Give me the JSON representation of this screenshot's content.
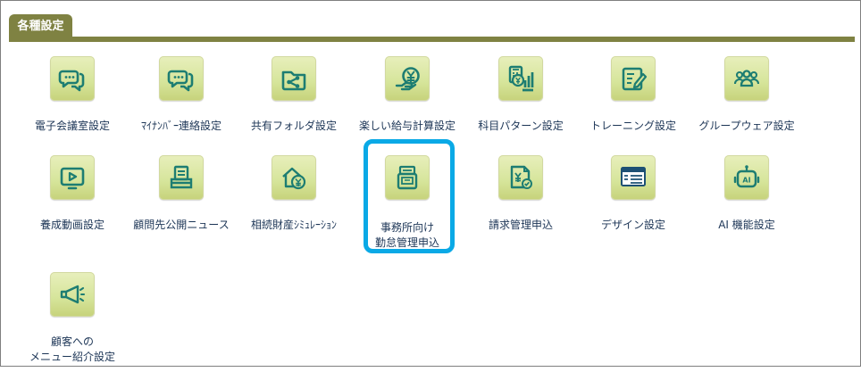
{
  "section": {
    "tab_label": "各種設定"
  },
  "settings": {
    "items": [
      {
        "label": "電子会議室設定",
        "icon": "chat-bubbles-icon"
      },
      {
        "label": "ﾏｲﾅﾝﾊﾞｰ連絡設定",
        "icon": "chat-bubbles-icon"
      },
      {
        "label": "共有フォルダ設定",
        "icon": "shared-folder-icon"
      },
      {
        "label": "楽しい給与計算設定",
        "icon": "salary-yen-icon"
      },
      {
        "label": "科目パターン設定",
        "icon": "calculator-chart-icon"
      },
      {
        "label": "トレーニング設定",
        "icon": "training-note-icon"
      },
      {
        "label": "グループウェア設定",
        "icon": "group-icon"
      },
      {
        "label": "養成動画設定",
        "icon": "video-play-icon"
      },
      {
        "label": "顧問先公開ニュース",
        "icon": "news-tray-icon"
      },
      {
        "label": "相続財産ｼﾐｭﾚｰｼｮﾝ",
        "icon": "home-yen-icon"
      },
      {
        "label": "事務所向け\n勤怠管理申込",
        "icon": "time-recorder-icon"
      },
      {
        "label": "請求管理申込",
        "icon": "invoice-yen-check-icon"
      },
      {
        "label": "デザイン設定",
        "icon": "design-window-icon"
      },
      {
        "label": "AI 機能設定",
        "icon": "ai-robot-icon"
      },
      {
        "label": "顧客への\nメニュー紹介設定",
        "icon": "megaphone-icon"
      }
    ]
  },
  "colors": {
    "tab": "#7f8242",
    "icon_background": "#d6e59b",
    "icon_stroke": "#1d7d72",
    "highlight": "#0aa9e6",
    "text": "#1c3556"
  }
}
